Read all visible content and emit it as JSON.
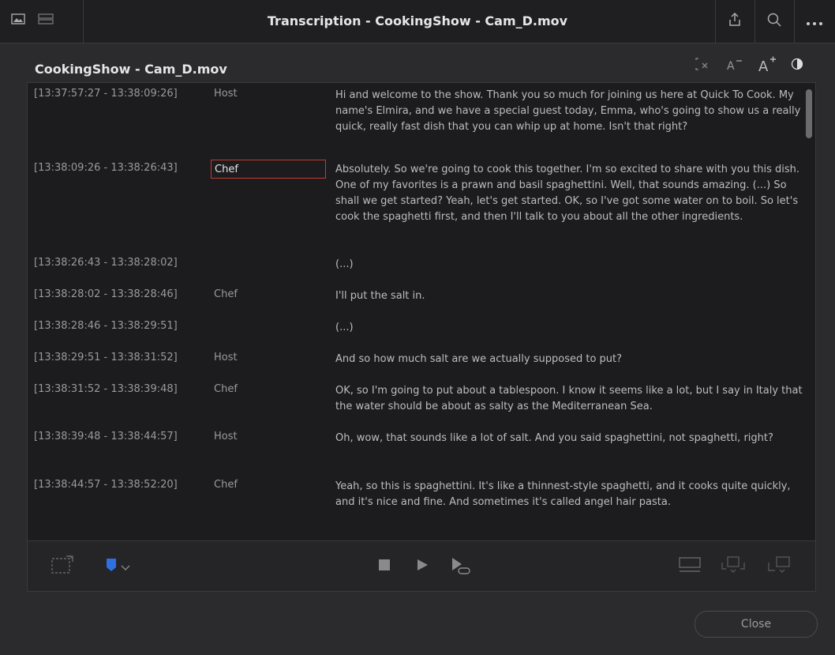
{
  "window": {
    "title": "Transcription - CookingShow - Cam_D.mov"
  },
  "header": {
    "clip_name": "CookingShow - Cam_D.mov"
  },
  "transcript": [
    {
      "timecode": "[13:37:57:27 - 13:38:09:26]",
      "speaker": "Host",
      "text": "Hi and welcome to the show. Thank you so much for joining us here at Quick To Cook. My name's Elmira, and we have a special guest today, Emma, who's going to show us a really quick, really fast dish that you can whip up at home. Isn't that right?"
    },
    {
      "timecode": "[13:38:09:26 - 13:38:26:43]",
      "speaker": "Chef",
      "text": "Absolutely. So we're going to cook this together. I'm so excited to share with you this dish. One of my favorites is a prawn and basil spaghettini. Well, that sounds amazing. (...) So shall we get started? Yeah, let's get started. OK, so I've got some water on to boil. So let's cook the spaghetti first, and then I'll talk to you about all the other ingredients."
    },
    {
      "timecode": "[13:38:26:43 - 13:38:28:02]",
      "speaker": "",
      "text": "(...)"
    },
    {
      "timecode": "[13:38:28:02 - 13:38:28:46]",
      "speaker": "Chef",
      "text": "I'll put the salt in."
    },
    {
      "timecode": "[13:38:28:46 - 13:38:29:51]",
      "speaker": "",
      "text": "(...)"
    },
    {
      "timecode": "[13:38:29:51 - 13:38:31:52]",
      "speaker": "Host",
      "text": "And so how much salt are we actually supposed to put?"
    },
    {
      "timecode": "[13:38:31:52 - 13:38:39:48]",
      "speaker": "Chef",
      "text": "OK, so I'm going to put about a tablespoon. I know it seems like a lot, but I say in Italy that the water should be about as salty as the Mediterranean Sea."
    },
    {
      "timecode": "[13:38:39:48 - 13:38:44:57]",
      "speaker": "Host",
      "text": "Oh, wow, that sounds like a lot of salt. And you said spaghettini, not spaghetti, right?"
    },
    {
      "timecode": "[13:38:44:57 - 13:38:52:20]",
      "speaker": "Chef",
      "text": "Yeah, so this is spaghettini. It's like a thinnest-style spaghetti, and it cooks quite quickly, and it's nice and fine. And sometimes it's called angel hair pasta."
    }
  ],
  "footer": {
    "close_label": "Close"
  },
  "colors": {
    "edit_border": "#c23a2e",
    "marker_blue": "#2f6fe0"
  }
}
